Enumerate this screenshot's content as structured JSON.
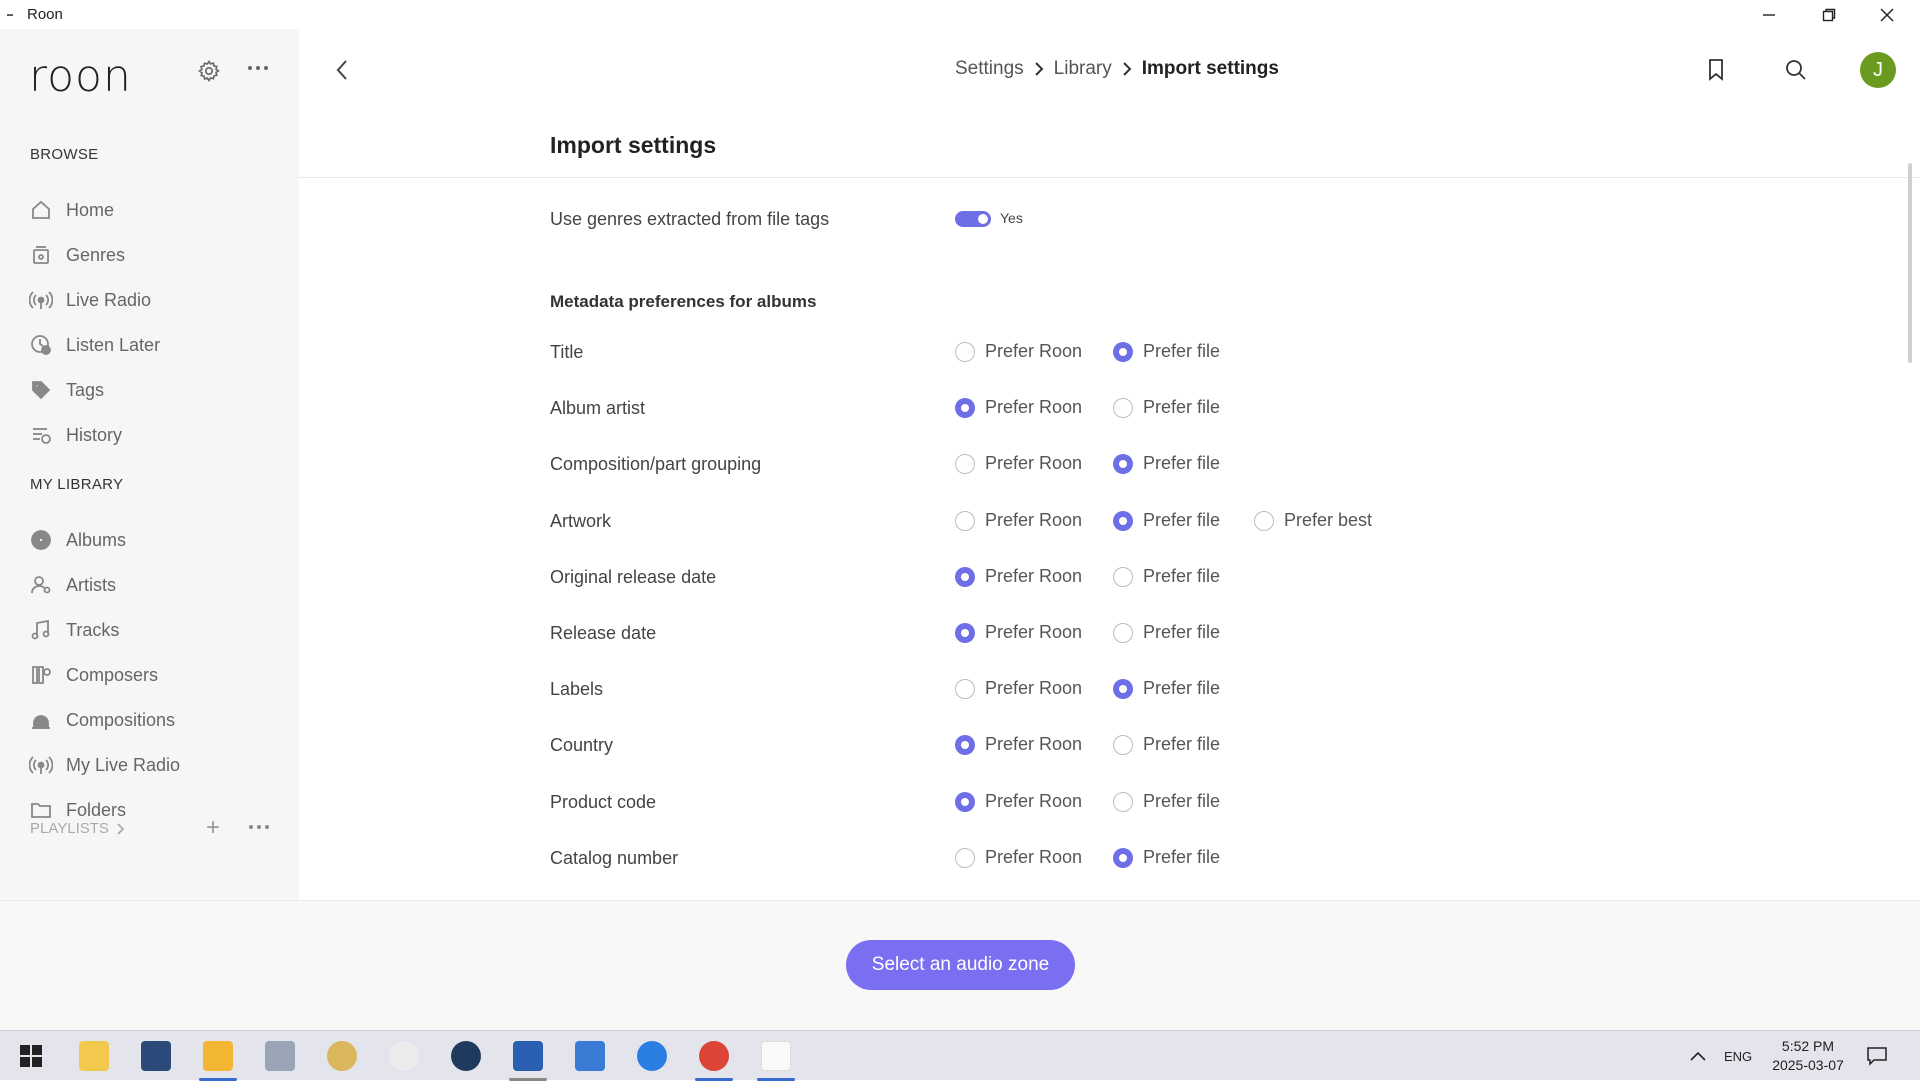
{
  "window": {
    "title": "Roon",
    "app_icon": "roon"
  },
  "sidebar": {
    "logo": "roon",
    "browse_heading": "BROWSE",
    "browse_items": [
      {
        "label": "Home",
        "icon": "home-icon"
      },
      {
        "label": "Genres",
        "icon": "genres-icon"
      },
      {
        "label": "Live Radio",
        "icon": "radio-icon"
      },
      {
        "label": "Listen Later",
        "icon": "clock-check-icon"
      },
      {
        "label": "Tags",
        "icon": "tag-icon"
      },
      {
        "label": "History",
        "icon": "history-icon"
      }
    ],
    "library_heading": "MY LIBRARY",
    "library_items": [
      {
        "label": "Albums",
        "icon": "album-icon"
      },
      {
        "label": "Artists",
        "icon": "artist-icon"
      },
      {
        "label": "Tracks",
        "icon": "music-note-icon"
      },
      {
        "label": "Composers",
        "icon": "composer-icon"
      },
      {
        "label": "Compositions",
        "icon": "composition-icon"
      },
      {
        "label": "My Live Radio",
        "icon": "radio-icon"
      },
      {
        "label": "Folders",
        "icon": "folder-icon"
      }
    ],
    "playlists_label": "PLAYLISTS"
  },
  "header": {
    "breadcrumb": [
      "Settings",
      "Library",
      "Import settings"
    ],
    "avatar_initial": "J"
  },
  "content": {
    "title": "Import settings",
    "genres_row": {
      "label": "Use genres extracted from file tags",
      "toggle_label": "Yes",
      "toggle_on": true
    },
    "albums_heading": "Metadata preferences for albums",
    "option_labels": {
      "roon": "Prefer Roon",
      "file": "Prefer file",
      "best": "Prefer best"
    },
    "rows": [
      {
        "label": "Title",
        "selected": "file"
      },
      {
        "label": "Album artist",
        "selected": "roon"
      },
      {
        "label": "Composition/part grouping",
        "selected": "file"
      },
      {
        "label": "Artwork",
        "selected": "file",
        "has_best": true
      },
      {
        "label": "Original release date",
        "selected": "roon"
      },
      {
        "label": "Release date",
        "selected": "roon"
      },
      {
        "label": "Labels",
        "selected": "file"
      },
      {
        "label": "Country",
        "selected": "roon"
      },
      {
        "label": "Product code",
        "selected": "roon"
      },
      {
        "label": "Catalog number",
        "selected": "file"
      }
    ]
  },
  "footer": {
    "zone_button": "Select an audio zone"
  },
  "taskbar": {
    "language": "ENG",
    "time": "5:52 PM",
    "date": "2025-03-07"
  },
  "colors": {
    "accent": "#6e6ee6",
    "zone_button": "#7a6ff0",
    "avatar": "#6a9a1f"
  }
}
